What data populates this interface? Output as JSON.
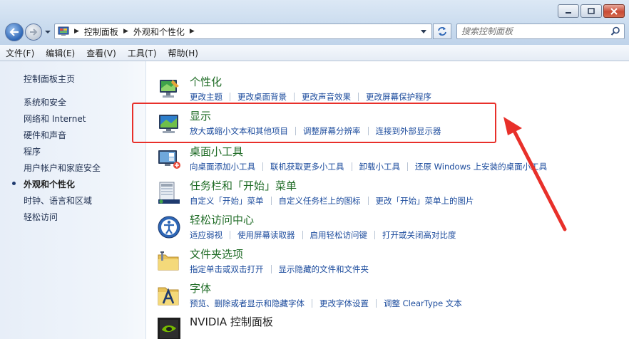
{
  "window": {
    "minimize_label": "minimize",
    "maximize_label": "maximize",
    "close_label": "close"
  },
  "address": {
    "crumbs": [
      "控制面板",
      "外观和个性化"
    ]
  },
  "search": {
    "placeholder": "搜索控制面板"
  },
  "menubar": {
    "items": [
      "文件(F)",
      "编辑(E)",
      "查看(V)",
      "工具(T)",
      "帮助(H)"
    ]
  },
  "sidebar": {
    "items": [
      {
        "label": "控制面板主页",
        "active": false
      },
      {
        "label": "系统和安全",
        "active": false
      },
      {
        "label": "网络和 Internet",
        "active": false
      },
      {
        "label": "硬件和声音",
        "active": false
      },
      {
        "label": "程序",
        "active": false
      },
      {
        "label": "用户帐户和家庭安全",
        "active": false
      },
      {
        "label": "外观和个性化",
        "active": true
      },
      {
        "label": "时钟、语言和区域",
        "active": false
      },
      {
        "label": "轻松访问",
        "active": false
      }
    ]
  },
  "categories": [
    {
      "title": "个性化",
      "icon": "personalization-icon",
      "links": [
        "更改主题",
        "更改桌面背景",
        "更改声音效果",
        "更改屏幕保护程序"
      ]
    },
    {
      "title": "显示",
      "icon": "display-icon",
      "links": [
        "放大或缩小文本和其他项目",
        "调整屏幕分辨率",
        "连接到外部显示器"
      ]
    },
    {
      "title": "桌面小工具",
      "icon": "gadgets-icon",
      "links": [
        "向桌面添加小工具",
        "联机获取更多小工具",
        "卸载小工具",
        "还原 Windows 上安装的桌面小工具"
      ]
    },
    {
      "title": "任务栏和「开始」菜单",
      "icon": "taskbar-icon",
      "links": [
        "自定义「开始」菜单",
        "自定义任务栏上的图标",
        "更改「开始」菜单上的图片"
      ]
    },
    {
      "title": "轻松访问中心",
      "icon": "ease-of-access-icon",
      "links": [
        "适应弱视",
        "使用屏幕读取器",
        "启用轻松访问键",
        "打开或关闭高对比度"
      ]
    },
    {
      "title": "文件夹选项",
      "icon": "folder-options-icon",
      "links": [
        "指定单击或双击打开",
        "显示隐藏的文件和文件夹"
      ]
    },
    {
      "title": "字体",
      "icon": "fonts-icon",
      "links": [
        "预览、删除或者显示和隐藏字体",
        "更改字体设置",
        "调整 ClearType 文本"
      ]
    },
    {
      "title": "NVIDIA 控制面板",
      "icon": "nvidia-icon",
      "links": []
    }
  ],
  "annotation": {
    "highlight_color": "#e8302a"
  }
}
